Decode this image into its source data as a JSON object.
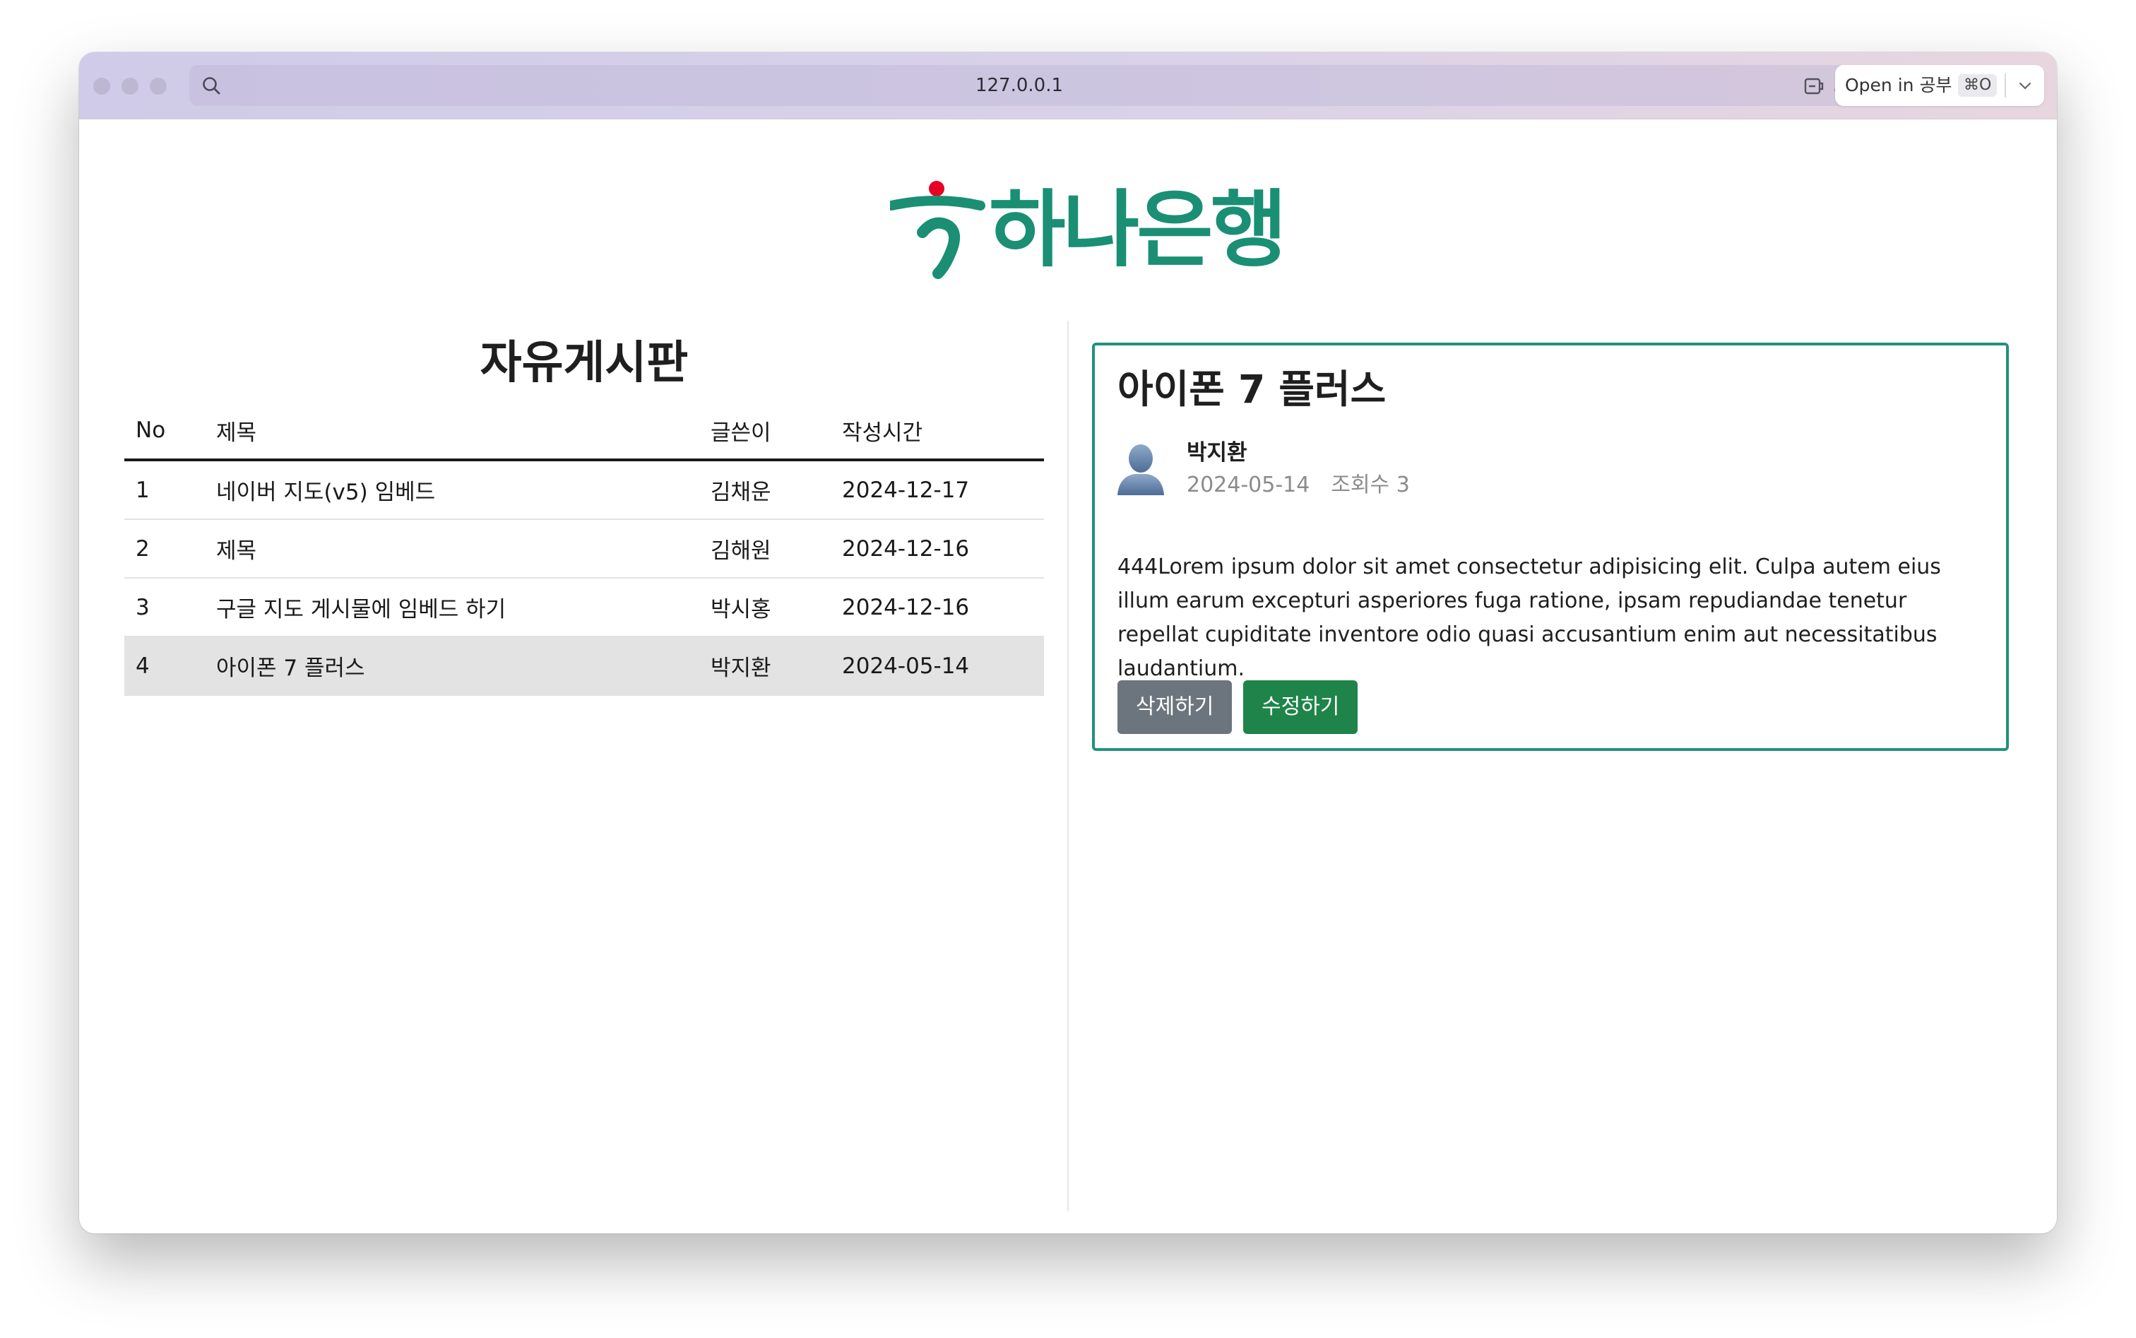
{
  "browser": {
    "url": "127.0.0.1",
    "open_in_label": "Open in 공부",
    "open_in_shortcut": "⌘O",
    "chrome_color": "#d6d0e8"
  },
  "logo": {
    "text": "하나은행",
    "brand_color": "#1a8f74",
    "dot_color": "#e60026"
  },
  "board": {
    "title": "자유게시판",
    "columns": [
      "No",
      "제목",
      "글쓴이",
      "작성시간"
    ],
    "rows": [
      {
        "no": "1",
        "title": "네이버 지도(v5) 임베드",
        "author": "김채운",
        "date": "2024-12-17"
      },
      {
        "no": "2",
        "title": "제목",
        "author": "김해원",
        "date": "2024-12-16"
      },
      {
        "no": "3",
        "title": "구글 지도 게시물에 임베드 하기",
        "author": "박시홍",
        "date": "2024-12-16"
      },
      {
        "no": "4",
        "title": "아이폰 7 플러스",
        "author": "박지환",
        "date": "2024-05-14"
      }
    ],
    "selected_row": 4
  },
  "post": {
    "title": "아이폰 7 플러스",
    "author": "박지환",
    "date": "2024-05-14",
    "views": "조회수 3",
    "body": "444Lorem ipsum dolor sit amet consectetur adipisicing elit. Culpa autem eius illum earum excepturi asperiores fuga ratione, ipsam repudiandae tenetur repellat cupiditate inventore odio quasi accusantium enim aut necessitatibus laudantium.",
    "delete_label": "삭제하기",
    "edit_label": "수정하기",
    "border_color": "#22927a"
  }
}
